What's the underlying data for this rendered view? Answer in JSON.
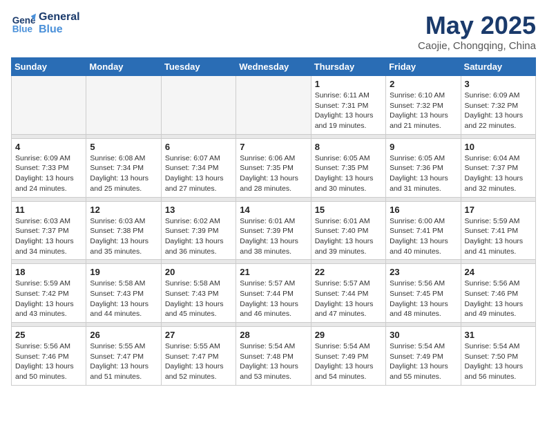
{
  "header": {
    "logo_line1": "General",
    "logo_line2": "Blue",
    "month": "May 2025",
    "location": "Caojie, Chongqing, China"
  },
  "weekdays": [
    "Sunday",
    "Monday",
    "Tuesday",
    "Wednesday",
    "Thursday",
    "Friday",
    "Saturday"
  ],
  "weeks": [
    [
      {
        "day": "",
        "info": ""
      },
      {
        "day": "",
        "info": ""
      },
      {
        "day": "",
        "info": ""
      },
      {
        "day": "",
        "info": ""
      },
      {
        "day": "1",
        "info": "Sunrise: 6:11 AM\nSunset: 7:31 PM\nDaylight: 13 hours\nand 19 minutes."
      },
      {
        "day": "2",
        "info": "Sunrise: 6:10 AM\nSunset: 7:32 PM\nDaylight: 13 hours\nand 21 minutes."
      },
      {
        "day": "3",
        "info": "Sunrise: 6:09 AM\nSunset: 7:32 PM\nDaylight: 13 hours\nand 22 minutes."
      }
    ],
    [
      {
        "day": "4",
        "info": "Sunrise: 6:09 AM\nSunset: 7:33 PM\nDaylight: 13 hours\nand 24 minutes."
      },
      {
        "day": "5",
        "info": "Sunrise: 6:08 AM\nSunset: 7:34 PM\nDaylight: 13 hours\nand 25 minutes."
      },
      {
        "day": "6",
        "info": "Sunrise: 6:07 AM\nSunset: 7:34 PM\nDaylight: 13 hours\nand 27 minutes."
      },
      {
        "day": "7",
        "info": "Sunrise: 6:06 AM\nSunset: 7:35 PM\nDaylight: 13 hours\nand 28 minutes."
      },
      {
        "day": "8",
        "info": "Sunrise: 6:05 AM\nSunset: 7:35 PM\nDaylight: 13 hours\nand 30 minutes."
      },
      {
        "day": "9",
        "info": "Sunrise: 6:05 AM\nSunset: 7:36 PM\nDaylight: 13 hours\nand 31 minutes."
      },
      {
        "day": "10",
        "info": "Sunrise: 6:04 AM\nSunset: 7:37 PM\nDaylight: 13 hours\nand 32 minutes."
      }
    ],
    [
      {
        "day": "11",
        "info": "Sunrise: 6:03 AM\nSunset: 7:37 PM\nDaylight: 13 hours\nand 34 minutes."
      },
      {
        "day": "12",
        "info": "Sunrise: 6:03 AM\nSunset: 7:38 PM\nDaylight: 13 hours\nand 35 minutes."
      },
      {
        "day": "13",
        "info": "Sunrise: 6:02 AM\nSunset: 7:39 PM\nDaylight: 13 hours\nand 36 minutes."
      },
      {
        "day": "14",
        "info": "Sunrise: 6:01 AM\nSunset: 7:39 PM\nDaylight: 13 hours\nand 38 minutes."
      },
      {
        "day": "15",
        "info": "Sunrise: 6:01 AM\nSunset: 7:40 PM\nDaylight: 13 hours\nand 39 minutes."
      },
      {
        "day": "16",
        "info": "Sunrise: 6:00 AM\nSunset: 7:41 PM\nDaylight: 13 hours\nand 40 minutes."
      },
      {
        "day": "17",
        "info": "Sunrise: 5:59 AM\nSunset: 7:41 PM\nDaylight: 13 hours\nand 41 minutes."
      }
    ],
    [
      {
        "day": "18",
        "info": "Sunrise: 5:59 AM\nSunset: 7:42 PM\nDaylight: 13 hours\nand 43 minutes."
      },
      {
        "day": "19",
        "info": "Sunrise: 5:58 AM\nSunset: 7:43 PM\nDaylight: 13 hours\nand 44 minutes."
      },
      {
        "day": "20",
        "info": "Sunrise: 5:58 AM\nSunset: 7:43 PM\nDaylight: 13 hours\nand 45 minutes."
      },
      {
        "day": "21",
        "info": "Sunrise: 5:57 AM\nSunset: 7:44 PM\nDaylight: 13 hours\nand 46 minutes."
      },
      {
        "day": "22",
        "info": "Sunrise: 5:57 AM\nSunset: 7:44 PM\nDaylight: 13 hours\nand 47 minutes."
      },
      {
        "day": "23",
        "info": "Sunrise: 5:56 AM\nSunset: 7:45 PM\nDaylight: 13 hours\nand 48 minutes."
      },
      {
        "day": "24",
        "info": "Sunrise: 5:56 AM\nSunset: 7:46 PM\nDaylight: 13 hours\nand 49 minutes."
      }
    ],
    [
      {
        "day": "25",
        "info": "Sunrise: 5:56 AM\nSunset: 7:46 PM\nDaylight: 13 hours\nand 50 minutes."
      },
      {
        "day": "26",
        "info": "Sunrise: 5:55 AM\nSunset: 7:47 PM\nDaylight: 13 hours\nand 51 minutes."
      },
      {
        "day": "27",
        "info": "Sunrise: 5:55 AM\nSunset: 7:47 PM\nDaylight: 13 hours\nand 52 minutes."
      },
      {
        "day": "28",
        "info": "Sunrise: 5:54 AM\nSunset: 7:48 PM\nDaylight: 13 hours\nand 53 minutes."
      },
      {
        "day": "29",
        "info": "Sunrise: 5:54 AM\nSunset: 7:49 PM\nDaylight: 13 hours\nand 54 minutes."
      },
      {
        "day": "30",
        "info": "Sunrise: 5:54 AM\nSunset: 7:49 PM\nDaylight: 13 hours\nand 55 minutes."
      },
      {
        "day": "31",
        "info": "Sunrise: 5:54 AM\nSunset: 7:50 PM\nDaylight: 13 hours\nand 56 minutes."
      }
    ]
  ]
}
